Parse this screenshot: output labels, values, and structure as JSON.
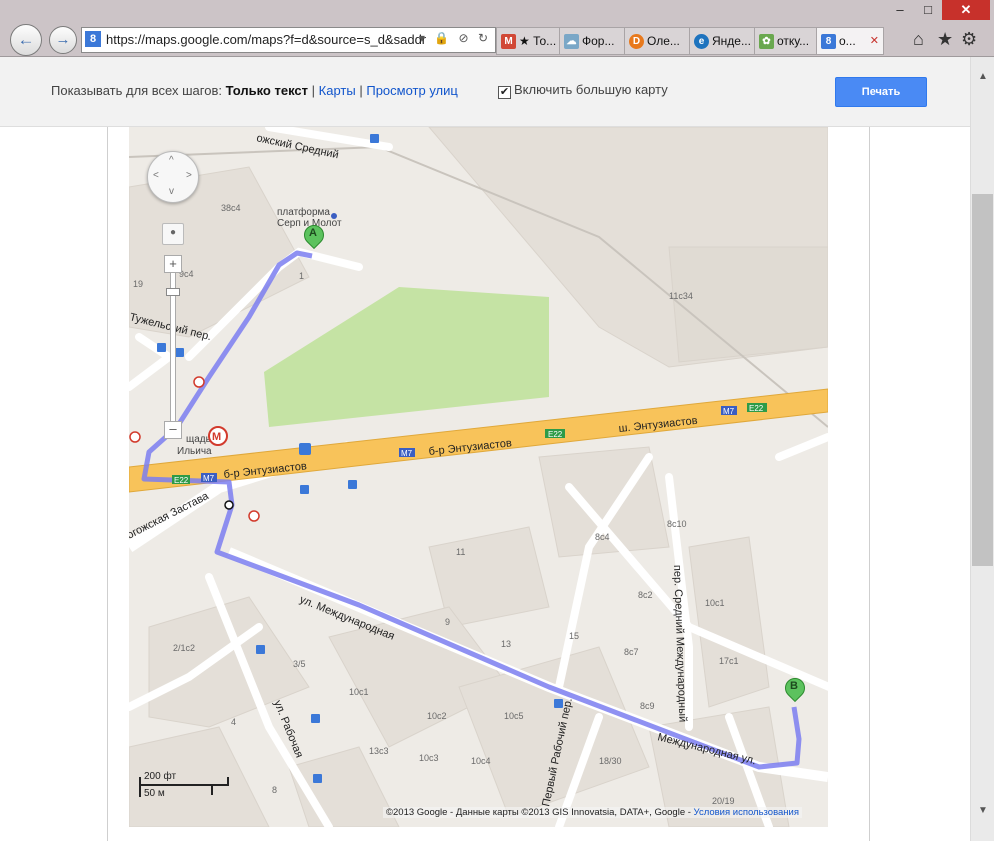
{
  "browser": {
    "back": "←",
    "forward": "→",
    "address": "https://maps.google.com/maps?f=d&source=s_d&saddr=9",
    "favicon": "8",
    "address_icons": "▾ 🔒 ⊘ ↻",
    "window_controls": {
      "minimize": "–",
      "maximize": "□",
      "close": "✕"
    },
    "tabs": [
      {
        "label": "★ То...",
        "icon": "M",
        "color": "#d14836"
      },
      {
        "label": "Фор...",
        "icon": "☁",
        "color": "#7aa7c7"
      },
      {
        "label": "Оле...",
        "icon": "D",
        "color": "#e8791d"
      },
      {
        "label": "Янде...",
        "icon": "e",
        "color": "#1e73be"
      },
      {
        "label": "отку...",
        "icon": "✿",
        "color": "#6aa84f"
      },
      {
        "label": "о...",
        "icon": "8",
        "color": "#3b78d8"
      }
    ],
    "active_tab_close": "✕",
    "toolbar_icons": {
      "home": "⌂",
      "favorites": "★",
      "settings": "⚙"
    }
  },
  "toolbar": {
    "show_for_all_steps": "Показывать для всех шагов:",
    "text_only": "Только текст",
    "separator": "|",
    "maps_link": "Карты",
    "street_view_link": "Просмотр улиц",
    "big_map_checked": "✔",
    "big_map_label": "Включить большую карту",
    "print_label": "Печать"
  },
  "map": {
    "controls": {
      "up": "^",
      "down": "v",
      "left": "<",
      "right": ">",
      "pegman": "●",
      "zoom_in": "+",
      "zoom_out": "–"
    },
    "markers": {
      "a": "A",
      "b": "B"
    },
    "labels": {
      "serp_srednij": "ожский Средний",
      "platform_line1": "платформа",
      "platform_line2": "Серп и Молот",
      "tuzhelskij": "Тужельский пер.",
      "ilyicha_line1": "щадь",
      "ilyicha_line2": "Ильича",
      "br_entuziastov_1": "б-р Энтузиастов",
      "br_entuziastov_2": "б-р Энтузиастов",
      "sh_entuziastov": "ш. Энтузиастов",
      "rogozhskaya": "огожская Застава",
      "mezhdunarodnaya_1": "ул. Международная",
      "mezhdunarodnaya_2": "Международная ул.",
      "srednij_mezhd": "пер. Средний Международный",
      "rabochaya": "ул. Рабочая",
      "pervyj_rabochij": "Первый Рабочий пер.",
      "m7_a": "M7",
      "e22_a": "E22",
      "m7_b": "M7",
      "e22_b": "E22",
      "m7_c": "M7",
      "e22_c": "E22"
    },
    "buildings": {
      "b38c4": "38c4",
      "b9c4": "9c4",
      "b19": "19",
      "b1": "1",
      "b11c34": "11c34",
      "b11": "11",
      "b8c10": "8c10",
      "b8c4": "8c4",
      "b8c2": "8c2",
      "b10c1a": "10c1",
      "b9": "9",
      "b13": "13",
      "b15": "15",
      "b8c7": "8c7",
      "b17c1": "17c1",
      "b2_1c2": "2/1c2",
      "b3_5": "3/5",
      "b10c1b": "10c1",
      "b10c2": "10c2",
      "b10c5": "10c5",
      "b8c9": "8c9",
      "b4": "4",
      "b13c3": "13c3",
      "b10c3": "10c3",
      "b10c4": "10c4",
      "b18_30": "18/30",
      "b8": "8",
      "b20_19": "20/19"
    },
    "metro": "M",
    "bus": "▣",
    "scale": {
      "ft": "200 фт",
      "m": "50 м"
    },
    "copyright": "©2013 Google - Данные карты ©2013 GIS Innovatsia, DATA+, Google -",
    "terms": "Условия использования",
    "colors": {
      "route": "#7b7ef0",
      "highway": "#f8c35a",
      "park": "#c5e3a4",
      "block": "#e4dfd8"
    }
  },
  "scroll": {
    "up": "▲",
    "down": "▼"
  }
}
